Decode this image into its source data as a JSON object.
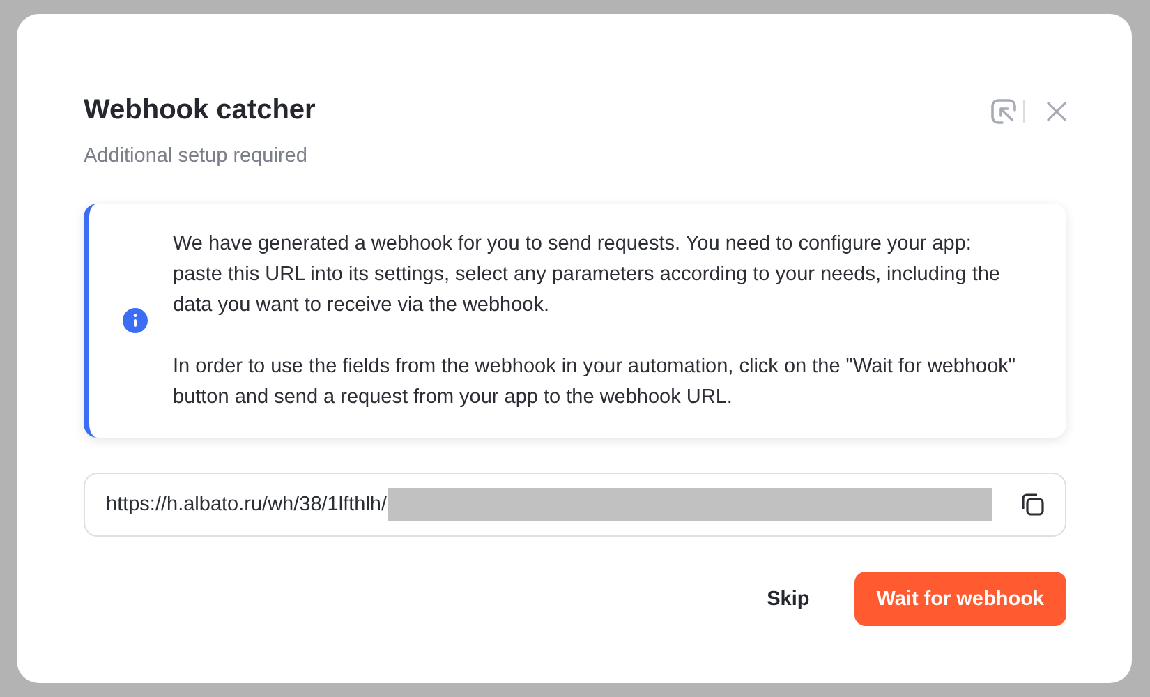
{
  "dialog": {
    "title": "Webhook catcher",
    "subtitle": "Additional setup required"
  },
  "info": {
    "paragraphs": [
      "We have generated a webhook for you to send requests. You need to configure your app: paste this URL into its settings, select any parameters according to your needs, including the data you want to receive via the webhook.",
      "In order to use the fields from the webhook in your automation, click on the \"Wait for webhook\" button and send a request from your app to the webhook URL."
    ]
  },
  "url_field": {
    "value": "https://h.albato.ru/wh/38/1lfthlh/",
    "redacted": true
  },
  "buttons": [
    {
      "label": "Skip",
      "kind": "secondary"
    },
    {
      "label": "Wait for webhook",
      "kind": "primary"
    }
  ]
}
